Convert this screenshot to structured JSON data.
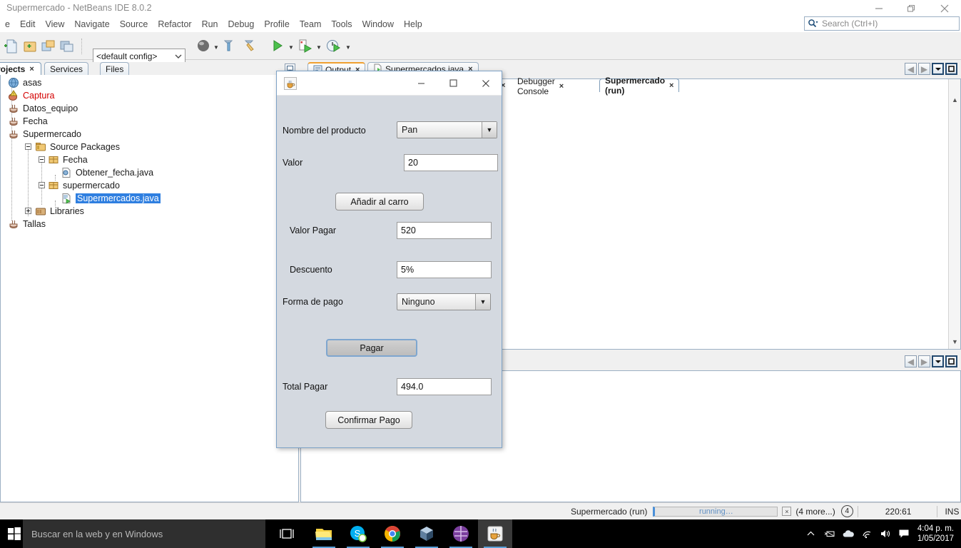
{
  "window": {
    "title": "Supermercado - NetBeans IDE 8.0.2",
    "minimize": "minimize-icon",
    "restore": "restore-icon",
    "close": "close-icon"
  },
  "menu": {
    "items": [
      "e",
      "Edit",
      "View",
      "Navigate",
      "Source",
      "Refactor",
      "Run",
      "Debug",
      "Profile",
      "Team",
      "Tools",
      "Window",
      "Help"
    ]
  },
  "search": {
    "placeholder": "Search (Ctrl+I)",
    "icon": "search-icon"
  },
  "toolbar": {
    "config_value": "<default config>",
    "buttons": [
      "new-file-icon",
      "new-project-icon",
      "open-project-icon",
      "save-all-icon",
      "build-icon",
      "clean-build-icon",
      "run-icon",
      "debug-icon",
      "profile-icon"
    ]
  },
  "left_panel": {
    "tabs": [
      {
        "label": "rojects",
        "active": true,
        "closable": true
      },
      {
        "label": "Services",
        "active": false,
        "closable": false
      },
      {
        "label": "Files",
        "active": false,
        "closable": false
      }
    ],
    "tree": [
      {
        "label": "asas",
        "depth": 0,
        "icon": "globe-icon",
        "color": "#000000"
      },
      {
        "label": "Captura",
        "depth": 0,
        "icon": "error-project-icon",
        "color": "#d40000"
      },
      {
        "label": "Datos_equipo",
        "depth": 0,
        "icon": "java-project-icon",
        "color": "#000000"
      },
      {
        "label": "Fecha",
        "depth": 0,
        "icon": "java-project-icon",
        "color": "#000000"
      },
      {
        "label": "Supermercado",
        "depth": 0,
        "icon": "java-project-icon",
        "color": "#000000"
      },
      {
        "label": "Source Packages",
        "depth": 1,
        "icon": "source-packages-icon",
        "color": "#000000",
        "expander": "minus"
      },
      {
        "label": "Fecha",
        "depth": 2,
        "icon": "package-icon",
        "color": "#000000",
        "expander": "minus"
      },
      {
        "label": "Obtener_fecha.java",
        "depth": 3,
        "icon": "java-file-icon",
        "color": "#000000"
      },
      {
        "label": "supermercado",
        "depth": 2,
        "icon": "package-icon",
        "color": "#000000",
        "expander": "minus"
      },
      {
        "label": "Supermercados.java",
        "depth": 3,
        "icon": "java-main-file-icon",
        "color": "#000000",
        "selected": true
      },
      {
        "label": "Libraries",
        "depth": 1,
        "icon": "libraries-icon",
        "color": "#000000",
        "expander": "plus"
      },
      {
        "label": "Tallas",
        "depth": 0,
        "icon": "java-project-icon",
        "color": "#000000"
      }
    ]
  },
  "editor_tabs": [
    {
      "label": "Output",
      "active": false,
      "closable": true,
      "icon": "output-icon"
    },
    {
      "label": "Supermercados.java",
      "active": false,
      "closable": true,
      "icon": "java-file-icon"
    }
  ],
  "output_tabs": [
    {
      "label": "Debugger Console",
      "active": false,
      "closable": true
    },
    {
      "label": "Supermercado (run)",
      "active": true,
      "closable": true
    }
  ],
  "panel_controls": {
    "scroll_left": "chevron-left-icon",
    "scroll_right": "chevron-right-icon",
    "list_button": "chevron-down-icon",
    "maximize_button": "maximize-icon",
    "minimize_button": "minimize-window-icon",
    "scroll_up": "chevron-up-icon",
    "scroll_down": "chevron-down-icon"
  },
  "dialog": {
    "icon": "java-coffee-icon",
    "minimize": "minimize-icon",
    "maximize": "maximize-icon",
    "close": "close-icon",
    "fields": {
      "producto_label": "Nombre del producto",
      "producto_value": "Pan",
      "valor_label": "Valor",
      "valor_value": "20",
      "anadir_button": "Añadir al carro",
      "valor_pagar_label": "Valor Pagar",
      "valor_pagar_value": "520",
      "descuento_label": "Descuento",
      "descuento_value": "5%",
      "forma_pago_label": "Forma de pago",
      "forma_pago_value": "Ninguno",
      "pagar_button": "Pagar",
      "total_pagar_label": "Total Pagar",
      "total_pagar_value": "494.0",
      "confirmar_button": "Confirmar Pago"
    }
  },
  "statusbar": {
    "task": "Supermercado (run)",
    "progress_text": "running…",
    "cancel_icon": "close-small-icon",
    "more": "(4 more...)",
    "badge": "4",
    "caret": "220:61",
    "insert_mode": "INS"
  },
  "taskbar": {
    "start_icon": "windows-start-icon",
    "search_placeholder": "Buscar en la web y en Windows",
    "task_view_icon": "task-view-icon",
    "apps": [
      {
        "icon": "file-explorer-icon",
        "active": false
      },
      {
        "icon": "skype-icon",
        "active": false
      },
      {
        "icon": "chrome-icon",
        "active": false
      },
      {
        "icon": "virtualbox-icon",
        "active": false
      },
      {
        "icon": "netbeans-icon",
        "active": false
      },
      {
        "icon": "java-app-icon",
        "active": true
      }
    ],
    "tray": [
      "show-hidden-icons-icon",
      "battery-icon",
      "onedrive-icon",
      "wifi-icon",
      "volume-icon",
      "action-center-icon"
    ],
    "time": "4:04 p. m.",
    "date": "1/05/2017"
  },
  "colors": {
    "accent": "#2f7fe0",
    "error": "#d40000",
    "panel_border": "#9cb0c4",
    "dialog_bg": "#d4d9e0"
  }
}
